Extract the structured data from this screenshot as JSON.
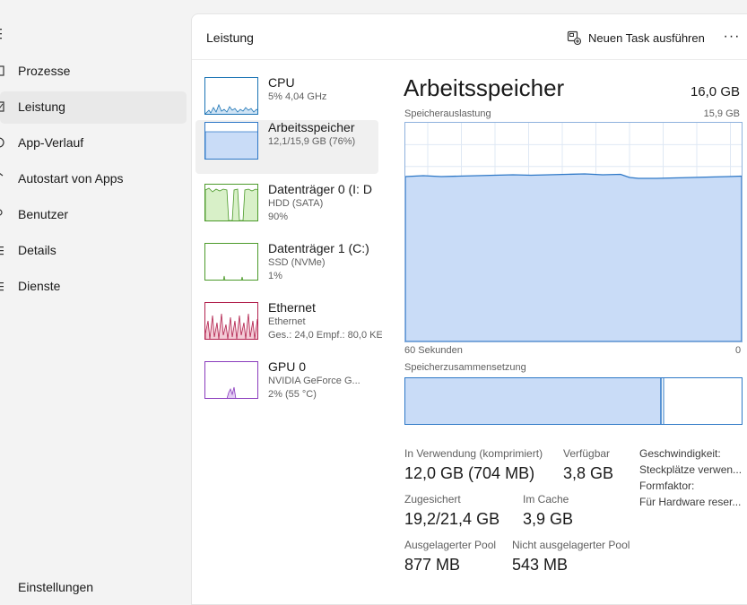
{
  "nav": {
    "items": [
      {
        "label": "Prozesse",
        "icon": "processes-icon"
      },
      {
        "label": "Leistung",
        "icon": "performance-icon"
      },
      {
        "label": "App-Verlauf",
        "icon": "app-history-icon"
      },
      {
        "label": "Autostart von Apps",
        "icon": "startup-apps-icon"
      },
      {
        "label": "Benutzer",
        "icon": "users-icon"
      },
      {
        "label": "Details",
        "icon": "details-icon"
      },
      {
        "label": "Dienste",
        "icon": "services-icon"
      }
    ],
    "settings_label": "Einstellungen",
    "active_index": 1
  },
  "header": {
    "title": "Leistung",
    "run_task_label": "Neuen Task ausführen",
    "more_label": "···"
  },
  "devices": [
    {
      "name": "CPU",
      "lines": [
        "5% 4,04 GHz"
      ],
      "color": "#1b74b5",
      "usage": 0.05
    },
    {
      "name": "Arbeitsspeicher",
      "lines": [
        "12,1/15,9 GB (76%)"
      ],
      "color": "#2e78c7",
      "usage": 0.76
    },
    {
      "name": "Datenträger 0 (I: D",
      "lines": [
        "HDD (SATA)",
        "90%"
      ],
      "color": "#4c9a2a",
      "usage": 0.9
    },
    {
      "name": "Datenträger 1 (C:)",
      "lines": [
        "SSD (NVMe)",
        "1%"
      ],
      "color": "#4c9a2a",
      "usage": 0.01
    },
    {
      "name": "Ethernet",
      "lines": [
        "Ethernet",
        "Ges.: 24,0 Empf.: 80,0 KE"
      ],
      "color": "#b2224e",
      "usage": 0.6
    },
    {
      "name": "GPU 0",
      "lines": [
        "NVIDIA GeForce G...",
        "2% (55 °C)"
      ],
      "color": "#8a3bbd",
      "usage": 0.02
    }
  ],
  "memory": {
    "title": "Arbeitsspeicher",
    "total": "16,0 GB",
    "usage_label": "Speicherauslastung",
    "usage_max": "15,9 GB",
    "time_left": "60 Sekunden",
    "time_right": "0",
    "composition_label": "Speicherzusammensetzung",
    "usage_fraction": 0.76,
    "composition_in_use_fraction": 0.76,
    "stats": {
      "in_use_label": "In Verwendung (komprimiert)",
      "in_use_value": "12,0 GB (704 MB)",
      "available_label": "Verfügbar",
      "available_value": "3,8 GB",
      "committed_label": "Zugesichert",
      "committed_value": "19,2/21,4 GB",
      "cached_label": "Im Cache",
      "cached_value": "3,9 GB",
      "paged_label": "Ausgelagerter Pool",
      "paged_value": "877 MB",
      "nonpaged_label": "Nicht ausgelagerter Pool",
      "nonpaged_value": "543 MB"
    },
    "properties": [
      "Geschwindigkeit:",
      "Steckplätze verwen...",
      "Formfaktor:",
      "Für Hardware reser..."
    ]
  },
  "colors": {
    "memory_fill": "#c9dcf7",
    "memory_line": "#2e78c7",
    "graph_grid": "#dfe8f4"
  }
}
